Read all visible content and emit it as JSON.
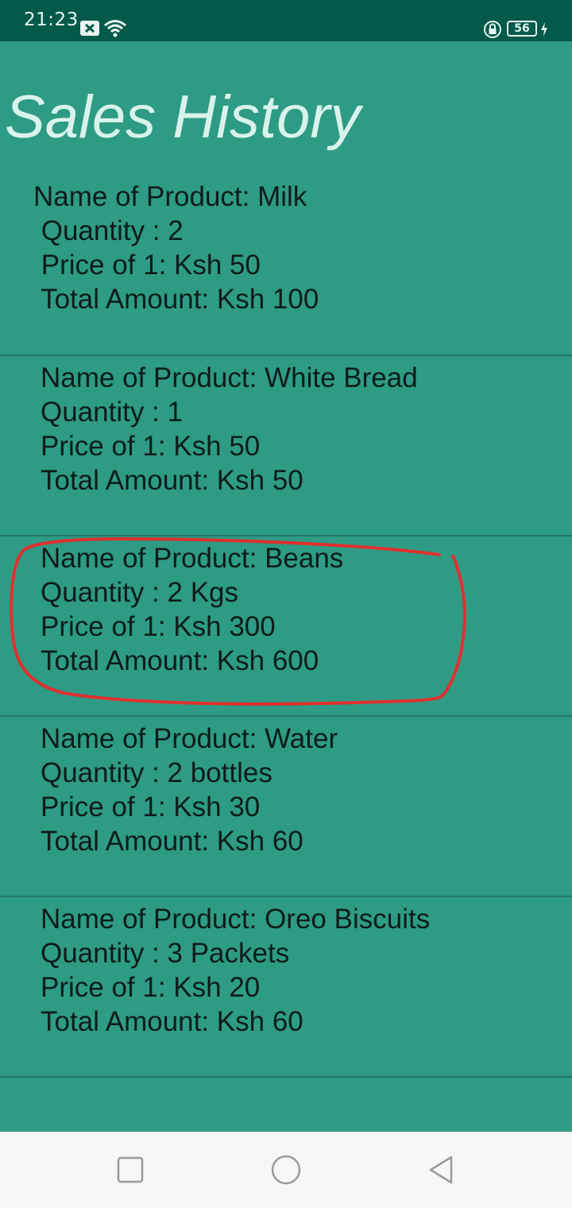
{
  "status_bar": {
    "time": "21:23",
    "battery": "56",
    "icons": [
      "notification-icon",
      "wifi-icon",
      "rotation-lock-icon",
      "battery-icon",
      "charging-icon"
    ]
  },
  "title": "Sales History",
  "sales": [
    {
      "name_line": "Name of Product: Milk",
      "quantity_line": " Quantity : 2",
      "price_line": " Price of 1: Ksh 50",
      "total_line": " Total Amount: Ksh 100"
    },
    {
      "name_line": "Name of Product: White Bread",
      "quantity_line": "Quantity : 1",
      "price_line": "Price of 1: Ksh 50",
      "total_line": "Total Amount: Ksh 50"
    },
    {
      "name_line": "Name of Product: Beans",
      "quantity_line": "Quantity : 2 Kgs",
      "price_line": "Price of 1: Ksh 300",
      "total_line": "Total Amount: Ksh 600"
    },
    {
      "name_line": "Name of Product: Water",
      "quantity_line": "Quantity : 2 bottles",
      "price_line": "Price of 1: Ksh 30",
      "total_line": "Total Amount: Ksh 60"
    },
    {
      "name_line": "Name of Product: Oreo Biscuits",
      "quantity_line": "Quantity : 3 Packets",
      "price_line": "Price of 1: Ksh 20",
      "total_line": "Total Amount: Ksh 60"
    }
  ],
  "colors": {
    "background": "#2e9b84",
    "status_bar": "#035a4a",
    "divider": "#1f7867",
    "annotation": "#e0302f",
    "nav_bar": "#f7f7f7"
  },
  "nav_icons": [
    "recent-apps-icon",
    "home-icon",
    "back-icon"
  ]
}
